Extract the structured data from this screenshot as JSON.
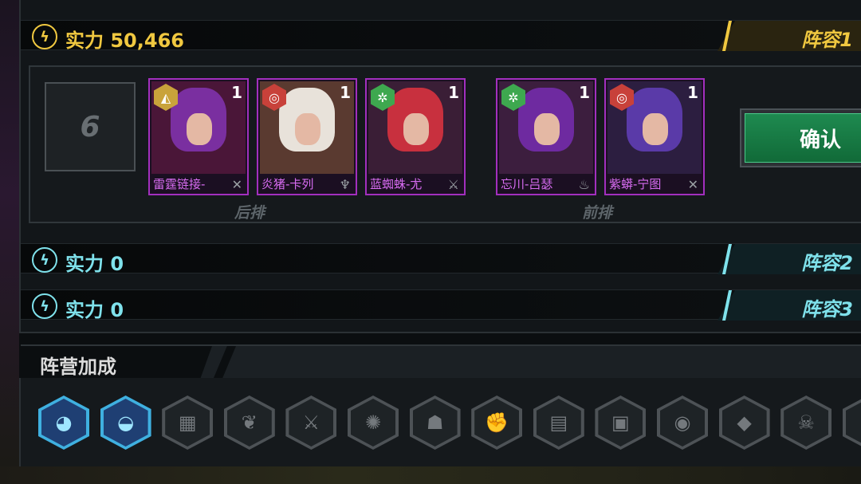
{
  "lineups": [
    {
      "power_label": "实力 50,466",
      "tab_label": "阵容1",
      "theme": "gold",
      "accent": "#f0c840"
    },
    {
      "power_label": "实力 0",
      "tab_label": "阵容2",
      "theme": "cyan",
      "accent": "#7fe2ec"
    },
    {
      "power_label": "实力 0",
      "tab_label": "阵容3",
      "theme": "cyan",
      "accent": "#7fe2ec"
    }
  ],
  "formation": {
    "slot_count": "6",
    "back_row_label": "后排",
    "front_row_label": "前排",
    "heroes": [
      {
        "name": "雷霆链接-",
        "level": "1",
        "badge_icon": "tri-link-icon",
        "badge_glyph": "◭",
        "badge_color": "#c9a33b",
        "role_icon": "crossed-swords-icon",
        "role_glyph": "✕",
        "hair": "#7a2fa0",
        "bg": "#4a1638"
      },
      {
        "name": "炎猪-卡列",
        "level": "1",
        "badge_icon": "target-icon",
        "badge_glyph": "◎",
        "badge_color": "#c8413a",
        "role_icon": "support-icon",
        "role_glyph": "♆",
        "hair": "#e8e2da",
        "bg": "#5a3a30"
      },
      {
        "name": "蓝蜘蛛-尤",
        "level": "1",
        "badge_icon": "leaf-icon",
        "badge_glyph": "✲",
        "badge_color": "#3ea84f",
        "role_icon": "claw-icon",
        "role_glyph": "⚔",
        "hair": "#c8303e",
        "bg": "#3a1e36"
      },
      {
        "name": "忘川-吕瑟",
        "level": "1",
        "badge_icon": "leaf-icon",
        "badge_glyph": "✲",
        "badge_color": "#3ea84f",
        "role_icon": "fire-icon",
        "role_glyph": "♨",
        "hair": "#6e2aa0",
        "bg": "#3c1e3e"
      },
      {
        "name": "紫蟒-宁图",
        "level": "1",
        "badge_icon": "target-icon",
        "badge_glyph": "◎",
        "badge_color": "#c8413a",
        "role_icon": "crossed-swords-icon",
        "role_glyph": "✕",
        "hair": "#5a3aa8",
        "bg": "#2c1e40"
      }
    ]
  },
  "confirm_label": "确认",
  "faction": {
    "title": "阵营加成",
    "icons": [
      {
        "name": "wolf-faction-icon",
        "glyph": "◕",
        "active": true
      },
      {
        "name": "crystal-faction-icon",
        "glyph": "◒",
        "active": true
      },
      {
        "name": "tablet-faction-icon",
        "glyph": "▦",
        "active": false
      },
      {
        "name": "wing-faction-icon",
        "glyph": "❦",
        "active": false
      },
      {
        "name": "blade-faction-icon",
        "glyph": "⚔",
        "active": false
      },
      {
        "name": "spike-faction-icon",
        "glyph": "✺",
        "active": false
      },
      {
        "name": "mask-faction-icon",
        "glyph": "☗",
        "active": false
      },
      {
        "name": "fist-faction-icon",
        "glyph": "✊",
        "active": false
      },
      {
        "name": "cards-faction-icon",
        "glyph": "▤",
        "active": false
      },
      {
        "name": "cube-faction-icon",
        "glyph": "▣",
        "active": false
      },
      {
        "name": "spiral-faction-icon",
        "glyph": "◉",
        "active": false
      },
      {
        "name": "vehicle-faction-icon",
        "glyph": "◆",
        "active": false
      },
      {
        "name": "skull-faction-icon",
        "glyph": "☠",
        "active": false
      },
      {
        "name": "partial-faction-icon",
        "glyph": "⬢",
        "active": false
      }
    ]
  }
}
